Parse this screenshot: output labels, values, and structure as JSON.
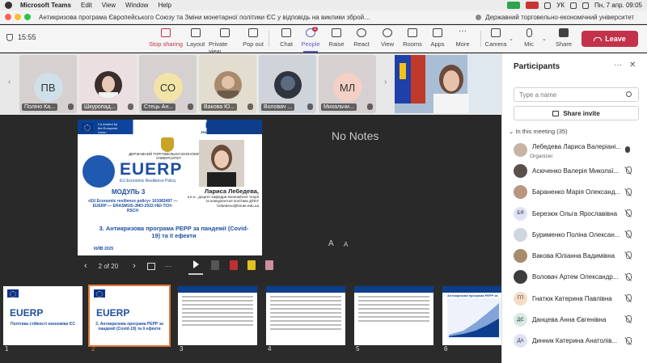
{
  "menubar": {
    "app": "Microsoft Teams",
    "menus": [
      "Edit",
      "View",
      "Window",
      "Help"
    ],
    "lang": "УК",
    "datetime": "Пн, 7 апр. 09:05"
  },
  "window": {
    "title": "Антикризова програма Європейського Союзу та Зміни монетарної політики ЄС у відповідь на виклики зброй…",
    "org": "Державний торговельно-економічний університет"
  },
  "toolbar": {
    "timer": "15:55",
    "stop_sharing": "Stop sharing",
    "layout": "Layout",
    "private_view": "Private view",
    "pop_out": "Pop out",
    "chat": "Chat",
    "people": "People",
    "people_badge": "1",
    "raise": "Raise",
    "react": "React",
    "view": "View",
    "rooms": "Rooms",
    "apps": "Apps",
    "more": "More",
    "camera": "Camera",
    "mic": "Mic",
    "share": "Share",
    "leave": "Leave"
  },
  "strip": {
    "tiles": [
      {
        "initials": "ПВ",
        "name": "Поліно Ка...",
        "color": "#cfe0e8"
      },
      {
        "initials": "",
        "name": "Шкуропад...",
        "color": "#e9d9dc"
      },
      {
        "initials": "СО",
        "name": "Стець Ан...",
        "color": "#f2e4a6"
      },
      {
        "initials": "",
        "name": "Вакова Ю...",
        "color": "#d8c9a8"
      },
      {
        "initials": "",
        "name": "Воловач ...",
        "color": "#9aa7b8"
      },
      {
        "initials": "МЛ",
        "name": "Михальчи...",
        "color": "#f3cfc6"
      }
    ]
  },
  "slide": {
    "cofunded": "Co-funded by the European Union",
    "university": "ДЕРЖАВНИЙ ТОРГОВЕЛЬНО-ЕКОНОМІЧНИЙ УНІВЕРСИТЕТ",
    "erasmus": "Erasmus+",
    "jean_monnet": "Jean Monnet Modules",
    "euerp": "EUERP",
    "euerp_sub": "EU Economic Resilience Policy",
    "module": "МОДУЛЬ 3",
    "project_lines": "«EU Economic resilience policy» 101083497 — EUERP — ERASMUS-JMO-2022-HEI-TCH-RSCH",
    "author_name": "Лариса Лебедева,",
    "author_info": "к.е.н., доцент кафедри економічної теорії та конкурентної політики ДТЕУ l.lebedevo@knute.edu.ua",
    "title": "3. Антикризова програма РЕРР за пандемії (Covid-19) та її ефекти",
    "city": "КИЇВ 2025"
  },
  "stage": {
    "no_notes": "No Notes",
    "font_down": "A",
    "font_up": "A",
    "page": "2 of 20",
    "prev": "‹",
    "next": "›"
  },
  "thumbnails": [
    {
      "num": "1",
      "big": "EUERP",
      "caption": "Політика стійкості економіки ЄС"
    },
    {
      "num": "2",
      "big": "EUERP",
      "caption": "3. Антикризова програма РЕРР за пандемії (Covid-19) та її ефекти"
    },
    {
      "num": "3",
      "big": "",
      "caption": ""
    },
    {
      "num": "4",
      "big": "",
      "caption": ""
    },
    {
      "num": "5",
      "big": "",
      "caption": ""
    },
    {
      "num": "6",
      "big": "",
      "caption": "Антикризова програма РЕРР за пандемії"
    }
  ],
  "participants": {
    "title": "Participants",
    "search_placeholder": "Type a name",
    "share_invite": "Share invite",
    "section": "In this meeting (35)",
    "list": [
      {
        "initials": "",
        "name": "Лебедева Лариса Валеріані...",
        "role": "Organizer",
        "color": "#c9b4a4",
        "muted": false
      },
      {
        "initials": "",
        "name": "Асюченко Валерія Миколаї...",
        "role": "",
        "color": "#5a4f4a",
        "muted": true
      },
      {
        "initials": "",
        "name": "Бараненко Марія Олександ...",
        "role": "",
        "color": "#b99680",
        "muted": true
      },
      {
        "initials": "БЯ",
        "name": "Березюк Ольга Ярославівна",
        "role": "",
        "color": "#dfe3f5",
        "muted": true
      },
      {
        "initials": "",
        "name": "Бурименко Поліна Олексан...",
        "role": "",
        "color": "#cfd6e0",
        "muted": true
      },
      {
        "initials": "",
        "name": "Вакова Юліанна Вадимівна",
        "role": "",
        "color": "#a88b6c",
        "muted": true
      },
      {
        "initials": "",
        "name": "Воловач Артем Олександр...",
        "role": "",
        "color": "#3d3d3d",
        "muted": true
      },
      {
        "initials": "ГП",
        "name": "Гнатюк Катерина Павлівна",
        "role": "",
        "color": "#f6dcc8",
        "muted": true
      },
      {
        "initials": "ДЄ",
        "name": "Данцева Анна Євгенівна",
        "role": "",
        "color": "#d6ece3",
        "muted": true
      },
      {
        "initials": "ДА",
        "name": "Динник Катерина Анатолів...",
        "role": "",
        "color": "#dfe3f5",
        "muted": true
      }
    ]
  }
}
